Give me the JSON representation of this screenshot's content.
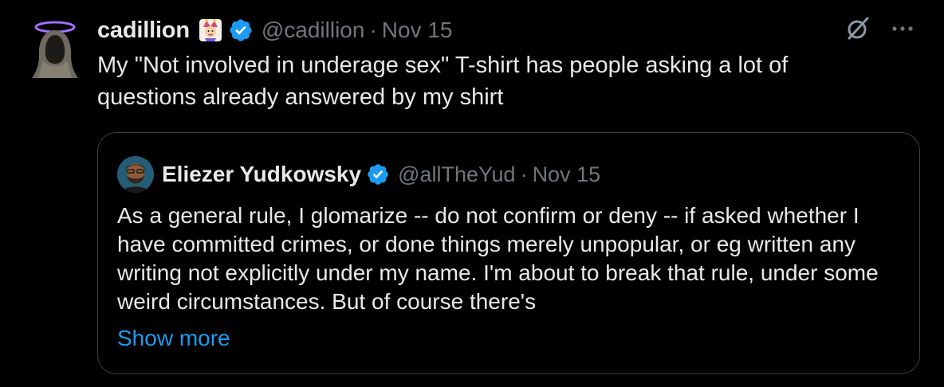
{
  "tweet": {
    "display_name": "cadillion",
    "handle": "@cadillion",
    "separator": "·",
    "date": "Nov 15",
    "text": "My \"Not involved in underage sex\" T-shirt has people asking a lot of questions already answered by my shirt",
    "emoji_badge": "jester-emoji-icon",
    "verified_icon": "verified-badge-icon"
  },
  "quote": {
    "display_name": "Eliezer Yudkowsky",
    "handle": "@allTheYud",
    "separator": "·",
    "date": "Nov 15",
    "text": "As a general rule, I glomarize -- do not confirm or deny -- if asked whether I have committed crimes, or done things merely unpopular, or eg written any writing not explicitly under my name.  I'm about to break that rule, under some weird circumstances.  But of course there's",
    "show_more": "Show more"
  },
  "colors": {
    "background": "#000000",
    "text_primary": "#e7e9ea",
    "text_secondary": "#71767b",
    "accent_blue": "#1d9bf0",
    "border": "#3b3f44"
  }
}
